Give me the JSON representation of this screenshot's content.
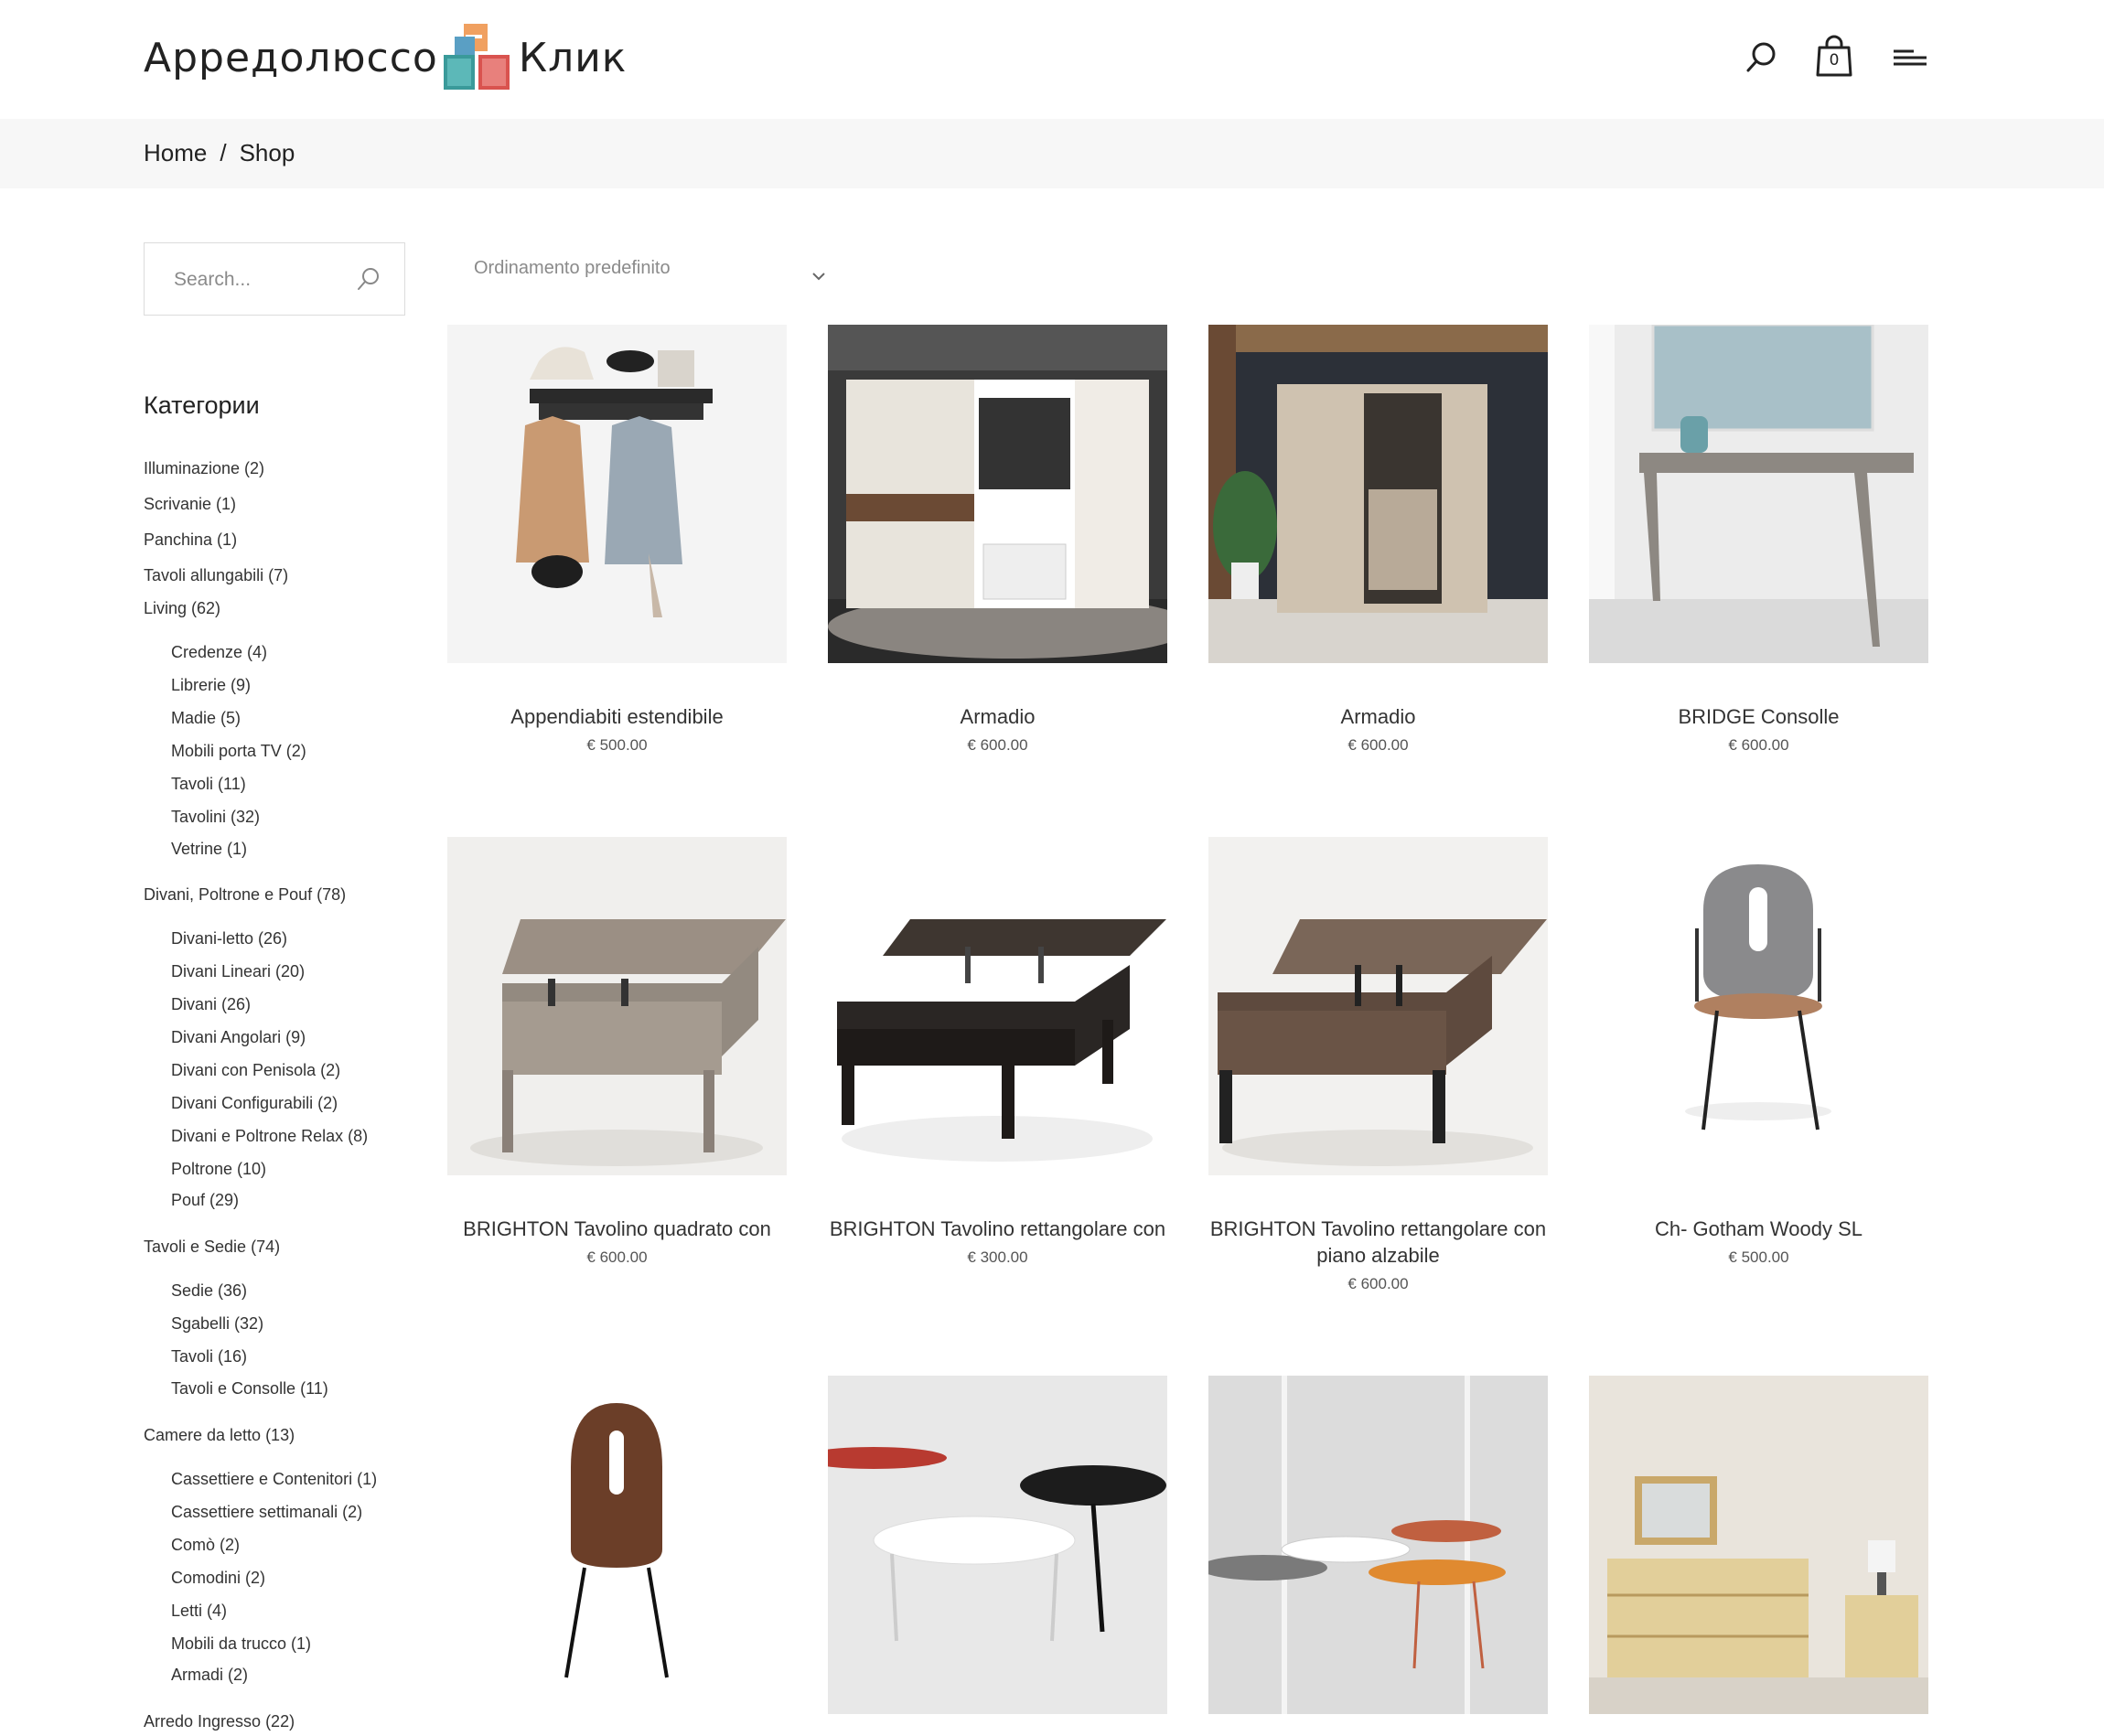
{
  "header": {
    "logo_left": "Арредолюссо",
    "logo_right": "Клик",
    "cart_count": "0"
  },
  "breadcrumb": {
    "home": "Home",
    "separator": "/",
    "current": "Shop"
  },
  "sidebar": {
    "search_placeholder": "Search...",
    "categories_title": "Категории",
    "categories": [
      {
        "label": "Illuminazione (2)",
        "sub": false
      },
      {
        "label": "Scrivanie (1)",
        "sub": false
      },
      {
        "label": "Panchina (1)",
        "sub": false
      },
      {
        "label": "Tavoli allungabili (7)",
        "sub": false
      },
      {
        "label": "Living (62)",
        "sub": false
      },
      {
        "label": "Credenze (4)",
        "sub": true
      },
      {
        "label": "Librerie (9)",
        "sub": true
      },
      {
        "label": "Madie (5)",
        "sub": true
      },
      {
        "label": "Mobili porta TV (2)",
        "sub": true
      },
      {
        "label": "Tavoli (11)",
        "sub": true
      },
      {
        "label": "Tavolini (32)",
        "sub": true
      },
      {
        "label": "Vetrine (1)",
        "sub": true
      },
      {
        "label": "Divani, Poltrone e Pouf (78)",
        "sub": false
      },
      {
        "label": "Divani-letto (26)",
        "sub": true
      },
      {
        "label": "Divani Lineari (20)",
        "sub": true
      },
      {
        "label": "Divani (26)",
        "sub": true
      },
      {
        "label": "Divani Angolari (9)",
        "sub": true
      },
      {
        "label": "Divani con Penisola (2)",
        "sub": true
      },
      {
        "label": "Divani Configurabili (2)",
        "sub": true
      },
      {
        "label": "Divani e Poltrone Relax (8)",
        "sub": true
      },
      {
        "label": "Poltrone (10)",
        "sub": true
      },
      {
        "label": "Pouf (29)",
        "sub": true
      },
      {
        "label": "Tavoli e Sedie  (74)",
        "sub": false
      },
      {
        "label": "Sedie (36)",
        "sub": true
      },
      {
        "label": "Sgabelli (32)",
        "sub": true
      },
      {
        "label": "Tavoli (16)",
        "sub": true
      },
      {
        "label": "Tavoli e Consolle (11)",
        "sub": true
      },
      {
        "label": "Camere da letto (13)",
        "sub": false
      },
      {
        "label": "Cassettiere e Contenitori (1)",
        "sub": true
      },
      {
        "label": "Cassettiere settimanali (2)",
        "sub": true
      },
      {
        "label": "Comò (2)",
        "sub": true
      },
      {
        "label": "Comodini (2)",
        "sub": true
      },
      {
        "label": "Letti (4)",
        "sub": true
      },
      {
        "label": "Mobili da trucco (1)",
        "sub": true
      },
      {
        "label": "Armadi (2)",
        "sub": true
      },
      {
        "label": "Arredo Ingresso (22)",
        "sub": false
      }
    ]
  },
  "sort": {
    "selected": "Ordinamento predefinito"
  },
  "products": [
    {
      "name": "Appendiabiti estendibile",
      "price": "€ 500.00"
    },
    {
      "name": "Armadio",
      "price": "€ 600.00"
    },
    {
      "name": "Armadio",
      "price": "€ 600.00"
    },
    {
      "name": "BRIDGE Consolle",
      "price": "€ 600.00"
    },
    {
      "name": "BRIGHTON Tavolino quadrato con",
      "price": "€ 600.00"
    },
    {
      "name": "BRIGHTON Tavolino rettangolare con",
      "price": "€ 300.00"
    },
    {
      "name": "BRIGHTON Tavolino rettangolare con piano alzabile",
      "price": "€ 600.00"
    },
    {
      "name": "Ch- Gotham Woody SL",
      "price": "€ 500.00"
    }
  ],
  "colors": {
    "logo_orange": "#f0a060",
    "logo_teal": "#3a9a9a",
    "logo_red": "#d9534f",
    "breadcrumb_bg": "#f7f7f7"
  }
}
